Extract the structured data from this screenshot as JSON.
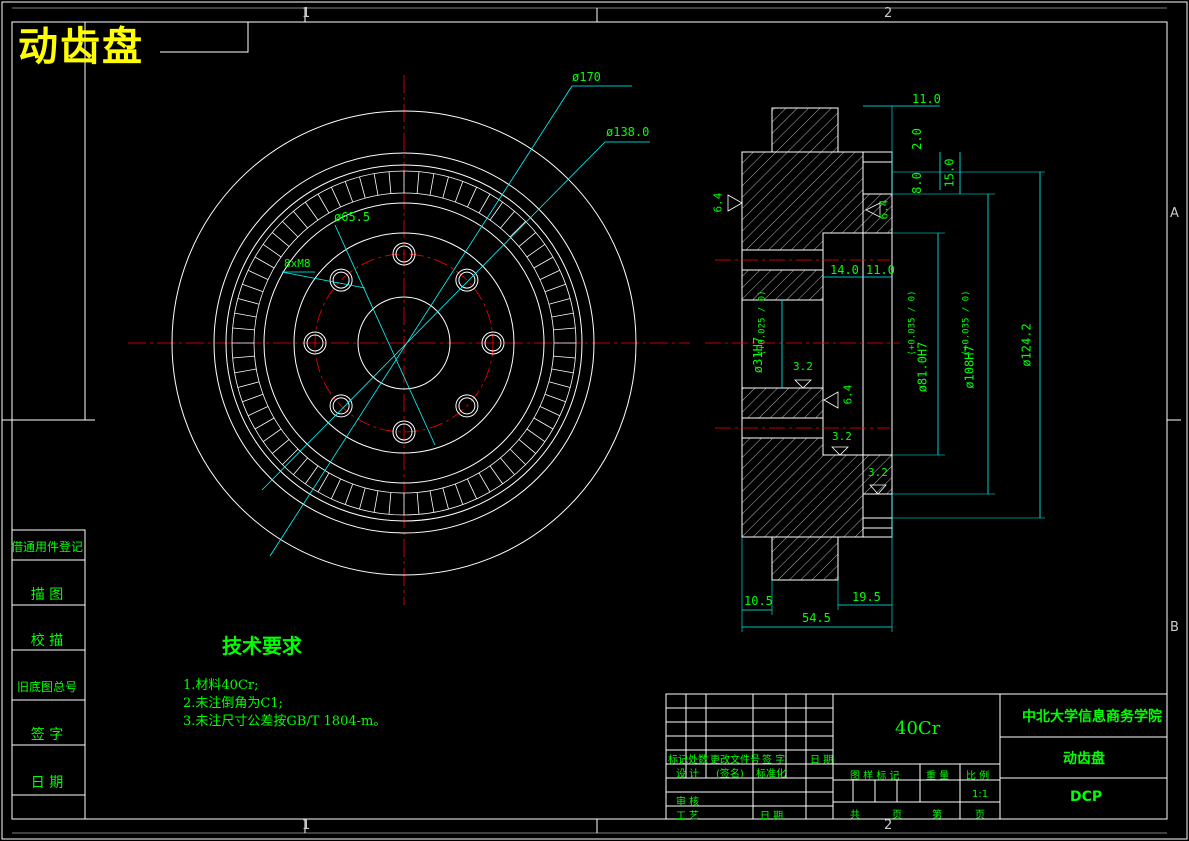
{
  "drawing": {
    "title": "动齿盘",
    "colors": {
      "background": "#000000",
      "outline": "#ffffff",
      "dimension": "#00ffff",
      "centerline": "#ff0000",
      "text": "#00ff00",
      "title": "#ffff00"
    }
  },
  "zones": {
    "top_1": "1",
    "top_2": "2",
    "bottom_1": "1",
    "bottom_2": "2",
    "right_a": "A",
    "right_b": "B"
  },
  "front_view": {
    "dim_outer": "ø170",
    "dim_ring": "ø138.0",
    "dim_bolt_circle": "ø65.5",
    "dim_holes": "8xM8"
  },
  "section_view": {
    "dim_top_width": "11.0",
    "dim_2": "2.0",
    "dim_8": "8.0",
    "dim_15": "15.0",
    "dim_14": "14.0",
    "dim_11": "11.0",
    "dim_bore": "ø31H7",
    "dim_bore_tol": "(+0.025 / 0)",
    "dim_81": "ø81.0H7",
    "dim_81_tol": "(+0.035 / 0)",
    "dim_108": "ø108H7",
    "dim_108_tol": "(+0.035 / 0)",
    "dim_124": "ø124.2",
    "dim_left": "10.5",
    "dim_19": "19.5",
    "dim_total": "54.5",
    "rough_64a": "6.4",
    "rough_64b": "6.4",
    "rough_64c": "6.4",
    "rough_32a": "3.2",
    "rough_32b": "3.2",
    "rough_32c": "3.2"
  },
  "requirements": {
    "title": "技术要求",
    "items": [
      "1.材料40Cr;",
      "2.未注倒角为C1;",
      "3.未注尺寸公差按GB/T 1804-m。"
    ]
  },
  "side_table": [
    "借通用件登记",
    "描 图",
    "校 描",
    "旧底图总号",
    "签 字",
    "日 期"
  ],
  "title_block": {
    "material": "40Cr",
    "school": "中北大学信息商务学院",
    "part_name": "动齿盘",
    "code": "DCP",
    "scale": "1:1",
    "row_headers": [
      "标记",
      "处数",
      "更改文件号",
      "签 字",
      "日 期"
    ],
    "design_row": [
      "设 计",
      "(签名)",
      "标准化"
    ],
    "review": "审 核",
    "process": "工 艺",
    "date": "日 期",
    "stage_labels": [
      "图 样 标 记",
      "重 量",
      "比 例"
    ],
    "sheets": [
      "共",
      "页",
      "第",
      "页"
    ]
  }
}
